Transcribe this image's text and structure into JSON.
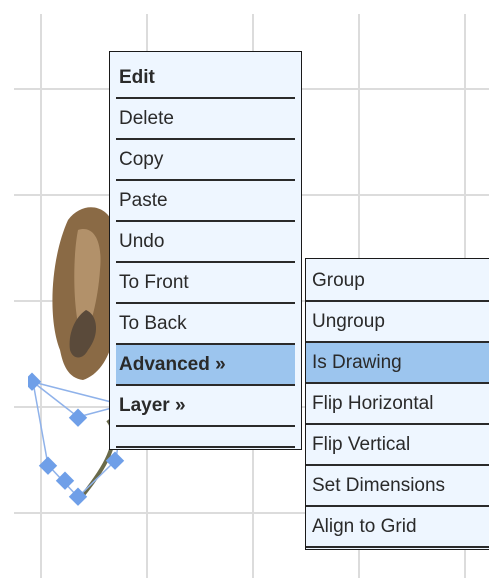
{
  "context_menu": {
    "items": [
      {
        "label": "Edit"
      },
      {
        "label": "Delete"
      },
      {
        "label": "Copy"
      },
      {
        "label": "Paste"
      },
      {
        "label": "Undo"
      },
      {
        "label": "To Front"
      },
      {
        "label": "To Back"
      },
      {
        "label": "Advanced »"
      },
      {
        "label": "Layer »"
      }
    ]
  },
  "submenu": {
    "items": [
      {
        "label": "Group"
      },
      {
        "label": "Ungroup"
      },
      {
        "label": "Is Drawing"
      },
      {
        "label": "Flip Horizontal"
      },
      {
        "label": "Flip Vertical"
      },
      {
        "label": "Set Dimensions"
      },
      {
        "label": "Align to Grid"
      }
    ]
  },
  "colors": {
    "menu_bg": "#eef6ff",
    "highlight": "#9cc5ee",
    "handle": "#6f9fe8",
    "grid": "#dcdcdc"
  }
}
